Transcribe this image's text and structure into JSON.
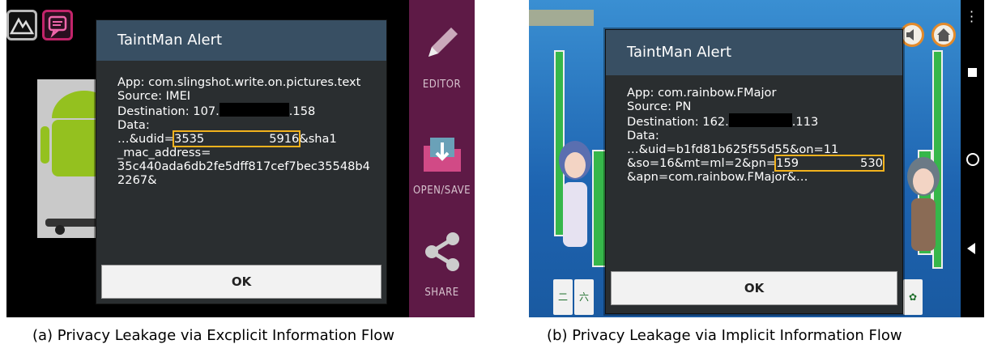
{
  "panel_a": {
    "sidebar": {
      "editor_label": "EDITOR",
      "open_save_label": "OPEN/SAVE",
      "share_label": "SHARE",
      "accent_color": "#5e1a46"
    },
    "dialog": {
      "title": "TaintMan Alert",
      "app_line": "App: com.slingshot.write.on.pictures.text",
      "source_line": "Source: IMEI",
      "dest_prefix": "Destination: 107.",
      "dest_suffix": ".158",
      "data_label": "Data:",
      "data_line1_prefix": "…&udid=",
      "udid_start": "3535",
      "udid_end": "5916",
      "data_line1_suffix": "&sha1",
      "data_line2": "_mac_address=",
      "data_line3": "35c440ada6db2fe5dff817cef7bec35548b4",
      "data_line4": "2267&",
      "ok_label": "OK"
    },
    "caption": "(a) Privacy Leakage via Excplicit Information Flow"
  },
  "panel_b": {
    "dialog": {
      "title": "TaintMan Alert",
      "app_line": "App: com.rainbow.FMajor",
      "source_line": "Source: PN",
      "dest_prefix": "Destination: 162.",
      "dest_suffix": ".113",
      "data_label": "Data:",
      "data_line1": "…&uid=b1fd81b625f55d55&on=11",
      "data_line2_prefix": "&so=16&mt=ml=2&pn=",
      "pn_start": "159",
      "pn_end": "530",
      "data_line3": "&apn=com.rainbow.FMajor&…",
      "ok_label": "OK"
    },
    "caption": "(b) Privacy Leakage via Implicit Information Flow"
  },
  "colors": {
    "highlight": "#f2b21d",
    "dialog_title_bg": "#384f63",
    "dialog_bg": "#2a2e30"
  }
}
